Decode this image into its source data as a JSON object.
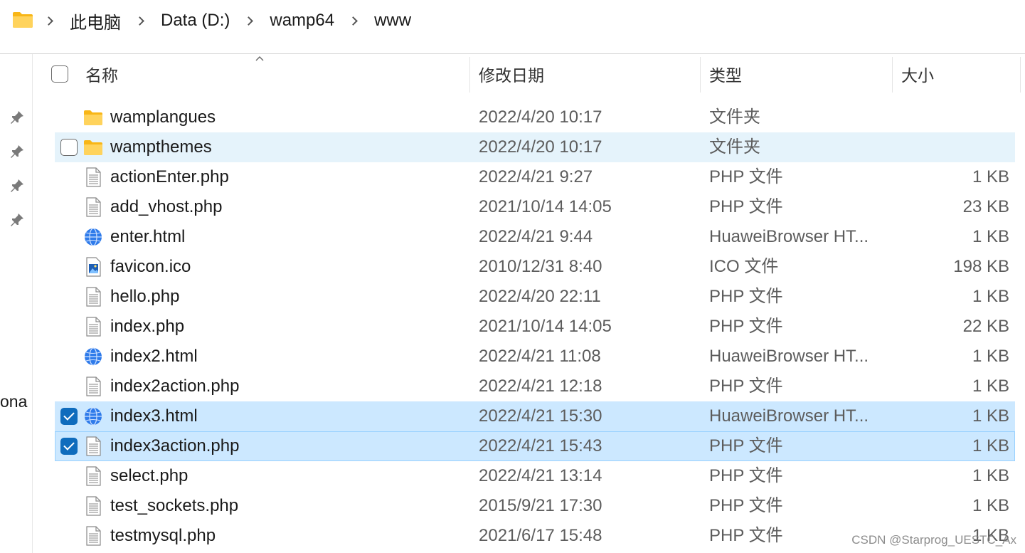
{
  "breadcrumb": {
    "icon": "folder-icon",
    "items": [
      "此电脑",
      "Data (D:)",
      "wamp64",
      "www"
    ]
  },
  "nav_strip": {
    "pins": [
      "pin-icon",
      "pin-icon",
      "pin-icon",
      "pin-icon"
    ],
    "partial_text": "ona"
  },
  "columns": {
    "name": "名称",
    "date": "修改日期",
    "type": "类型",
    "size": "大小"
  },
  "rows": [
    {
      "name": "wamplangues",
      "date": "2022/4/20 10:17",
      "type": "文件夹",
      "size": "",
      "icon": "folder-icon",
      "state": "normal"
    },
    {
      "name": "wampthemes",
      "date": "2022/4/20 10:17",
      "type": "文件夹",
      "size": "",
      "icon": "folder-icon",
      "state": "hover"
    },
    {
      "name": "actionEnter.php",
      "date": "2022/4/21 9:27",
      "type": "PHP 文件",
      "size": "1 KB",
      "icon": "document-icon",
      "state": "normal"
    },
    {
      "name": "add_vhost.php",
      "date": "2021/10/14 14:05",
      "type": "PHP 文件",
      "size": "23 KB",
      "icon": "document-icon",
      "state": "normal"
    },
    {
      "name": "enter.html",
      "date": "2022/4/21 9:44",
      "type": "HuaweiBrowser HT...",
      "size": "1 KB",
      "icon": "browser-globe-icon",
      "state": "normal"
    },
    {
      "name": "favicon.ico",
      "date": "2010/12/31 8:40",
      "type": "ICO 文件",
      "size": "198 KB",
      "icon": "image-file-icon",
      "state": "normal"
    },
    {
      "name": "hello.php",
      "date": "2022/4/20 22:11",
      "type": "PHP 文件",
      "size": "1 KB",
      "icon": "document-icon",
      "state": "normal"
    },
    {
      "name": "index.php",
      "date": "2021/10/14 14:05",
      "type": "PHP 文件",
      "size": "22 KB",
      "icon": "document-icon",
      "state": "normal"
    },
    {
      "name": "index2.html",
      "date": "2022/4/21 11:08",
      "type": "HuaweiBrowser HT...",
      "size": "1 KB",
      "icon": "browser-globe-icon",
      "state": "normal"
    },
    {
      "name": "index2action.php",
      "date": "2022/4/21 12:18",
      "type": "PHP 文件",
      "size": "1 KB",
      "icon": "document-icon",
      "state": "normal"
    },
    {
      "name": "index3.html",
      "date": "2022/4/21 15:30",
      "type": "HuaweiBrowser HT...",
      "size": "1 KB",
      "icon": "browser-globe-icon",
      "state": "selected"
    },
    {
      "name": "index3action.php",
      "date": "2022/4/21 15:43",
      "type": "PHP 文件",
      "size": "1 KB",
      "icon": "document-icon",
      "state": "selected-focused"
    },
    {
      "name": "select.php",
      "date": "2022/4/21 13:14",
      "type": "PHP 文件",
      "size": "1 KB",
      "icon": "document-icon",
      "state": "normal"
    },
    {
      "name": "test_sockets.php",
      "date": "2015/9/21 17:30",
      "type": "PHP 文件",
      "size": "1 KB",
      "icon": "document-icon",
      "state": "normal"
    },
    {
      "name": "testmysql.php",
      "date": "2021/6/17 15:48",
      "type": "PHP 文件",
      "size": "1 KB",
      "icon": "document-icon",
      "state": "normal"
    }
  ],
  "watermark": "CSDN @Starprog_UESTC_Ax",
  "colors": {
    "hover_row": "#e5f3fb",
    "selected_row": "#cce8ff",
    "checkbox_checked": "#0f6cbd",
    "folder": "#ffc83d"
  }
}
